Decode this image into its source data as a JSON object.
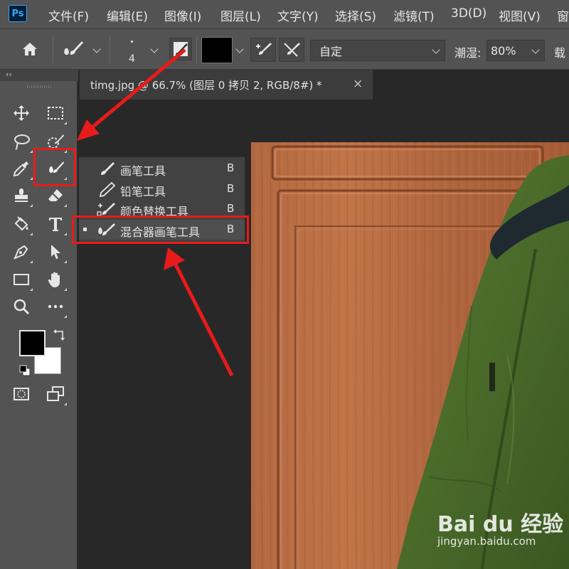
{
  "app": {
    "logo": "Ps"
  },
  "menu": [
    "文件(F)",
    "编辑(E)",
    "图像(I)",
    "图层(L)",
    "文字(Y)",
    "选择(S)",
    "滤镜(T)",
    "3D(D)",
    "视图(V)",
    "窗"
  ],
  "options": {
    "brush_size": "4",
    "mode_value": "自定",
    "wet_label": "潮湿:",
    "wet_value": "80%",
    "load_label": "载"
  },
  "document_tab": {
    "title": "timg.jpg @ 66.7% (图层 0 拷贝 2, RGB/8#) *",
    "close": "×"
  },
  "toolbar": {
    "collapse": "‹‹"
  },
  "flyout": {
    "items": [
      {
        "label": "画笔工具",
        "key": "B",
        "icon": "brush-icon",
        "selected": false
      },
      {
        "label": "铅笔工具",
        "key": "B",
        "icon": "pencil-icon",
        "selected": false
      },
      {
        "label": "颜色替换工具",
        "key": "B",
        "icon": "color-replacement-icon",
        "selected": false
      },
      {
        "label": "混合器画笔工具",
        "key": "B",
        "icon": "mixer-brush-icon",
        "selected": true
      }
    ]
  },
  "colors": {
    "annotation": "#e81b1b",
    "foreground": "#000000",
    "background": "#ffffff",
    "door": "#b5673f",
    "jacket": "#4a6b2c"
  },
  "watermark": {
    "brand": "Bai du 经验",
    "url": "jingyan.baidu.com"
  }
}
